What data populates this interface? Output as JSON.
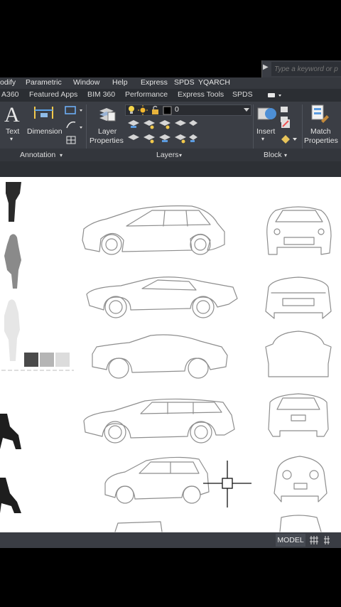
{
  "search": {
    "placeholder": "Type a keyword or phrase"
  },
  "menu": [
    "odify",
    "Parametric",
    "Window",
    "Help",
    "Express",
    "SPDS",
    "YQARCH"
  ],
  "tabs": [
    "A360",
    "Featured Apps",
    "BIM 360",
    "Performance",
    "Express Tools",
    "SPDS"
  ],
  "ribbon": {
    "annotation": {
      "text_label": "Text",
      "dimension_label": "Dimension",
      "panel_title": "Annotation"
    },
    "layers": {
      "layer_properties_line1": "Layer",
      "layer_properties_line2": "Properties",
      "current_layer": "0",
      "panel_title": "Layers"
    },
    "block": {
      "insert_label": "Insert",
      "panel_title": "Block"
    },
    "properties": {
      "match_line1": "Match",
      "match_line2": "Properties"
    }
  },
  "status": {
    "model_tab": "MODEL"
  },
  "colors": {
    "ribbon_bg": "#3b3e45",
    "canvas_bg": "#ffffff",
    "line_gray": "#8e8e8e",
    "swatch_dark": "#4a4a4a",
    "swatch_mid": "#b5b5b5",
    "swatch_light": "#dcdcdc"
  },
  "icons": [
    "search-arrow-icon",
    "text-a-icon",
    "dimension-icon",
    "layer-properties-icon",
    "lightbulb-icon",
    "sun-icon",
    "lock-icon",
    "insert-block-icon",
    "match-properties-icon",
    "crosshair-cursor-icon",
    "grid-icon"
  ]
}
